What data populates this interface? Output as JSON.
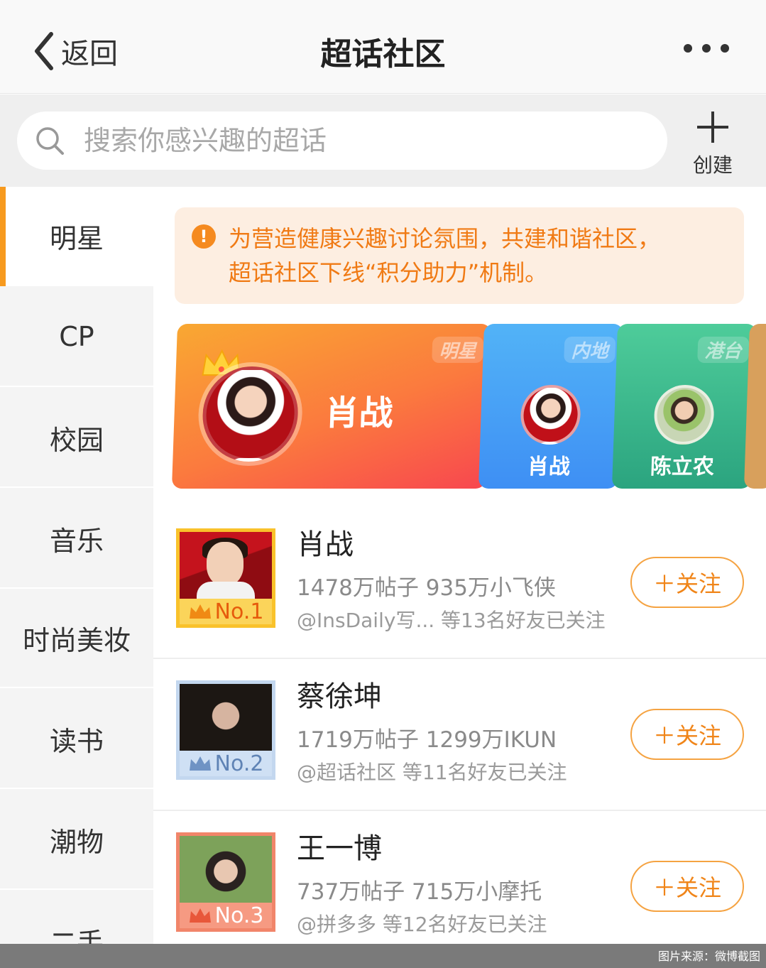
{
  "header": {
    "back_label": "返回",
    "title": "超话社区"
  },
  "search": {
    "placeholder": "搜索你感兴趣的超话",
    "create_label": "创建"
  },
  "sidebar": {
    "items": [
      {
        "label": "明星",
        "active": true
      },
      {
        "label": "CP"
      },
      {
        "label": "校园"
      },
      {
        "label": "音乐"
      },
      {
        "label": "时尚美妆"
      },
      {
        "label": "读书"
      },
      {
        "label": "潮物"
      },
      {
        "label": "二手"
      }
    ]
  },
  "notice": {
    "line1": "为营造健康兴趣讨论氛围，共建和谐社区，",
    "line2": "超话社区下线“积分助力”机制。"
  },
  "banners": [
    {
      "tag": "明星",
      "name": "肖战"
    },
    {
      "tag": "内地",
      "name": "肖战"
    },
    {
      "tag": "港台",
      "name": "陈立农"
    }
  ],
  "ranking": [
    {
      "rank": "No.1",
      "name": "肖战",
      "stats": "1478万帖子 935万小飞侠",
      "friends": "@InsDaily写... 等13名好友已关注",
      "follow_label": "＋关注"
    },
    {
      "rank": "No.2",
      "name": "蔡徐坤",
      "stats": "1719万帖子 1299万IKUN",
      "friends": "@超话社区 等11名好友已关注",
      "follow_label": "＋关注"
    },
    {
      "rank": "No.3",
      "name": "王一博",
      "stats": "737万帖子 715万小摩托",
      "friends": "@拼多多 等12名好友已关注",
      "follow_label": "＋关注"
    }
  ],
  "footer": {
    "credit": "图片来源：微博截图"
  },
  "colors": {
    "accent": "#f79a1e",
    "notice_text": "#f07a14",
    "follow": "#f08519"
  }
}
